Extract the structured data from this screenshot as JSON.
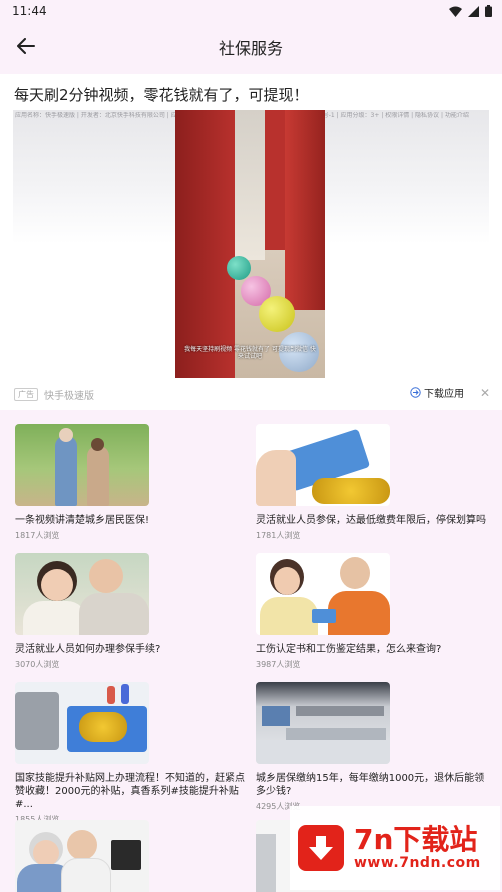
{
  "status_bar": {
    "time": "11:44"
  },
  "app_bar": {
    "title": "社保服务"
  },
  "ad": {
    "headline": "每天刷2分钟视频，零花钱就有了，可提现！",
    "info_line": "应用名称：快手极速版 | 开发者：北京快手科技有限公司 | 应用版本：12.9.20.8827 | 备案号：京ICP备15023260号-1 | 应用分级：3+ | 权限详情 | 隐私协议 | 功能介绍",
    "video_caption": "我每天坚持刷视频 零花钱就有了 可提现到微信 快来试试吧",
    "badge": "广告",
    "advertiser": "快手极速版",
    "download_label": "下载应用",
    "close_icon": "close-icon"
  },
  "articles": [
    {
      "title": "一条视频讲清楚城乡居民医保!",
      "views": "1817人浏览"
    },
    {
      "title": "灵活就业人员参保，达最低缴费年限后，停保划算吗",
      "views": "1781人浏览"
    },
    {
      "title": "灵活就业人员如何办理参保手续?",
      "views": "3070人浏览"
    },
    {
      "title": "工伤认定书和工伤鉴定结果，怎么来查询?",
      "views": "3987人浏览"
    },
    {
      "title": "国家技能提升补贴网上办理流程！不知道的，赶紧点赞收藏！2000元的补贴，真香系列#技能提升补贴 #...",
      "views": "1855人浏览"
    },
    {
      "title": "城乡居保缴纳15年，每年缴纳1000元，退休后能领多少钱?",
      "views": "4295人浏览"
    },
    {
      "title": "",
      "views": ""
    },
    {
      "title": "",
      "views": ""
    }
  ],
  "watermark": {
    "name": "7n下载站",
    "url": "www.7ndn.com"
  }
}
